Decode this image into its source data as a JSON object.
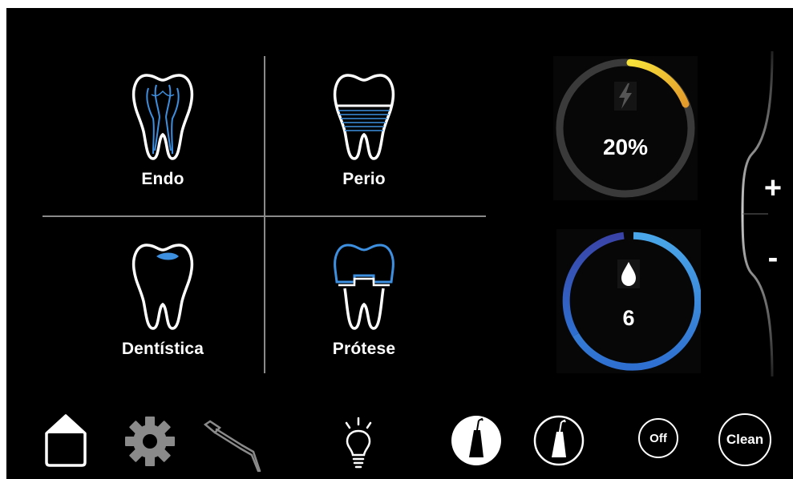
{
  "modes": [
    {
      "id": "endo",
      "label": "Endo",
      "icon": "tooth-root-canal-icon"
    },
    {
      "id": "perio",
      "label": "Perio",
      "icon": "tooth-perio-icon"
    },
    {
      "id": "dentistica",
      "label": "Dentística",
      "icon": "tooth-filling-icon"
    },
    {
      "id": "protese",
      "label": "Prótese",
      "icon": "tooth-crown-icon"
    }
  ],
  "power": {
    "value": "20%",
    "level": 0.2,
    "icon": "lightning-icon",
    "accent": "#f5c518"
  },
  "water": {
    "value": "6",
    "level": 1.0,
    "icon": "water-drop-icon",
    "accent": "#3d8fe0"
  },
  "adjust": {
    "plus": "+",
    "minus": "-"
  },
  "toolbar": {
    "home_icon": "home-icon",
    "settings_icon": "gear-icon",
    "handpiece_icon": "handpiece-icon",
    "light_icon": "light-bulb-icon",
    "tip_selected_icon": "ultrasonic-tip-selected-icon",
    "tip_icon": "ultrasonic-tip-icon",
    "off_label": "Off",
    "clean_label": "Clean"
  },
  "colors": {
    "background": "#000000",
    "accent_blue": "#3d8fe0",
    "power_yellow": "#f5c518",
    "track": "#3a3a3a"
  }
}
